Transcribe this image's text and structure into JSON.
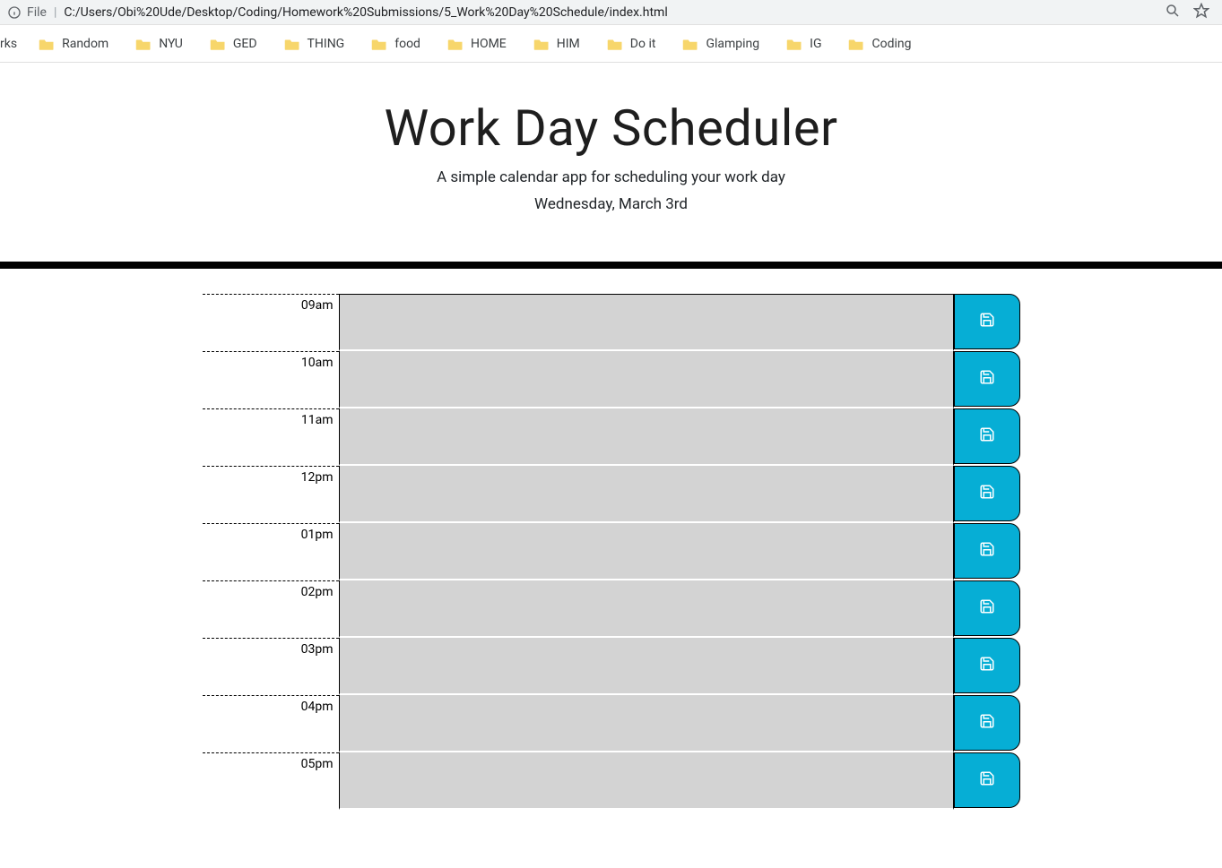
{
  "browser": {
    "file_label": "File",
    "url": "C:/Users/Obi%20Ude/Desktop/Coding/Homework%20Submissions/5_Work%20Day%20Schedule/index.html"
  },
  "bookmarks": {
    "cut_label": "rks",
    "items": [
      {
        "label": "Random"
      },
      {
        "label": "NYU"
      },
      {
        "label": "GED"
      },
      {
        "label": "THING"
      },
      {
        "label": "food"
      },
      {
        "label": "HOME"
      },
      {
        "label": "HIM"
      },
      {
        "label": "Do it"
      },
      {
        "label": "Glamping"
      },
      {
        "label": "IG"
      },
      {
        "label": "Coding"
      }
    ]
  },
  "header": {
    "title": "Work Day Scheduler",
    "subtitle": "A simple calendar app for scheduling your work day",
    "date": "Wednesday, March 3rd"
  },
  "schedule": {
    "rows": [
      {
        "hour": "09am",
        "text": ""
      },
      {
        "hour": "10am",
        "text": ""
      },
      {
        "hour": "11am",
        "text": ""
      },
      {
        "hour": "12pm",
        "text": ""
      },
      {
        "hour": "01pm",
        "text": ""
      },
      {
        "hour": "02pm",
        "text": ""
      },
      {
        "hour": "03pm",
        "text": ""
      },
      {
        "hour": "04pm",
        "text": ""
      },
      {
        "hour": "05pm",
        "text": ""
      }
    ]
  }
}
